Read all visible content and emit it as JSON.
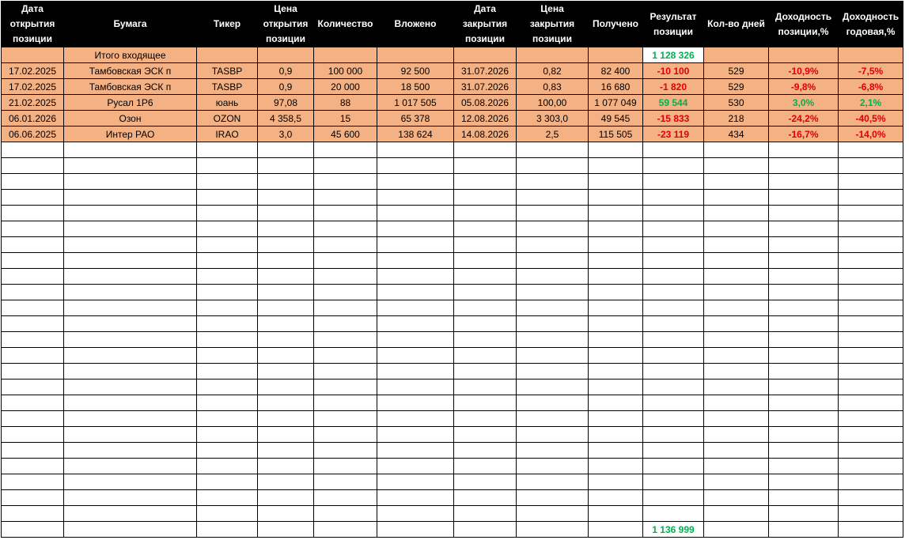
{
  "colors": {
    "header_bg": "#000000",
    "header_text": "#ffffff",
    "row_fill": "#f4b183",
    "positive": "#00b050",
    "negative": "#e00000"
  },
  "headers": [
    "Дата открытия позиции",
    "Бумага",
    "Тикер",
    "Цена открытия позиции",
    "Количество",
    "Вложено",
    "Дата закрытия позиции",
    "Цена закрытия позиции",
    "Получено",
    "Результат позиции",
    "Кол-во дней",
    "Доходность позиции,%",
    "Доходность годовая,%"
  ],
  "summary": {
    "label": "Итого входящее",
    "result": "1 128 326"
  },
  "rows": [
    {
      "open_date": "17.02.2025",
      "security": "Тамбовская ЭСК п",
      "ticker": "TASBP",
      "open_price": "0,9",
      "qty": "100 000",
      "invested": "92 500",
      "close_date": "31.07.2026",
      "close_price": "0,82",
      "received": "82 400",
      "result": "-10 100",
      "days": "529",
      "pos_yield": "-10,9%",
      "annual_yield": "-7,5%",
      "sign": "neg"
    },
    {
      "open_date": "17.02.2025",
      "security": "Тамбовская ЭСК п",
      "ticker": "TASBP",
      "open_price": "0,9",
      "qty": "20 000",
      "invested": "18 500",
      "close_date": "31.07.2026",
      "close_price": "0,83",
      "received": "16 680",
      "result": "-1 820",
      "days": "529",
      "pos_yield": "-9,8%",
      "annual_yield": "-6,8%",
      "sign": "neg"
    },
    {
      "open_date": "21.02.2025",
      "security": "Русал 1Р6",
      "ticker": "юань",
      "open_price": "97,08",
      "qty": "88",
      "invested": "1 017 505",
      "close_date": "05.08.2026",
      "close_price": "100,00",
      "received": "1 077 049",
      "result": "59 544",
      "days": "530",
      "pos_yield": "3,0%",
      "annual_yield": "2,1%",
      "sign": "pos"
    },
    {
      "open_date": "06.01.2026",
      "security": "Озон",
      "ticker": "OZON",
      "open_price": "4 358,5",
      "qty": "15",
      "invested": "65 378",
      "close_date": "12.08.2026",
      "close_price": "3 303,0",
      "received": "49 545",
      "result": "-15 833",
      "days": "218",
      "pos_yield": "-24,2%",
      "annual_yield": "-40,5%",
      "sign": "neg"
    },
    {
      "open_date": "06.06.2025",
      "security": "Интер РАО",
      "ticker": "IRAO",
      "open_price": "3,0",
      "qty": "45 600",
      "invested": "138 624",
      "close_date": "14.08.2026",
      "close_price": "2,5",
      "received": "115 505",
      "result": "-23 119",
      "days": "434",
      "pos_yield": "-16,7%",
      "annual_yield": "-14,0%",
      "sign": "neg"
    }
  ],
  "total": {
    "result": "1 136 999"
  }
}
